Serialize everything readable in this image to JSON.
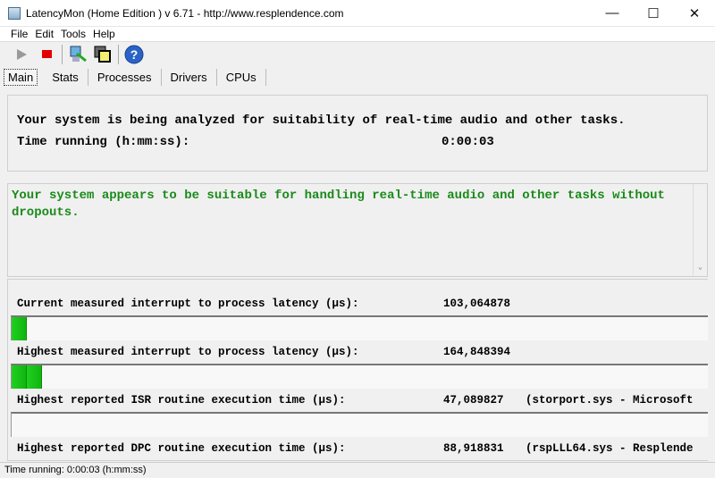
{
  "window": {
    "title": "LatencyMon  (Home Edition )  v 6.71 - http://www.resplendence.com",
    "minimize": "—",
    "maximize": "☐",
    "close": "✕"
  },
  "menu": [
    "File",
    "Edit",
    "Tools",
    "Help"
  ],
  "toolbar": [
    "play-icon",
    "stop-icon",
    "analyze-icon",
    "windows-icon",
    "help-icon"
  ],
  "tabs": [
    "Main",
    "Stats",
    "Processes",
    "Drivers",
    "CPUs"
  ],
  "main": {
    "analysis_text": "Your system is being analyzed for suitability of real-time audio and other tasks.",
    "time_label": "Time running (h:mm:ss):",
    "time_value": "0:00:03",
    "verdict": "Your system appears to be suitable for handling real-time audio and other tasks without dropouts.",
    "verdict_color": "#1a8a1a",
    "metrics": [
      {
        "label": "Current measured interrupt to process latency (µs):",
        "value": "103,064878",
        "detail": "",
        "segments": 1
      },
      {
        "label": "Highest measured interrupt to process latency (µs):",
        "value": "164,848394",
        "detail": "",
        "segments": 2
      },
      {
        "label": "Highest reported ISR routine execution time (µs):",
        "value": "47,089827",
        "detail": "(storport.sys - Microsoft",
        "segments": 0
      },
      {
        "label": "Highest reported DPC routine execution time (µs):",
        "value": "88,918831",
        "detail": "(rspLLL64.sys - Resplende",
        "segments": null
      }
    ]
  },
  "status": "Time running: 0:00:03  (h:mm:ss)"
}
